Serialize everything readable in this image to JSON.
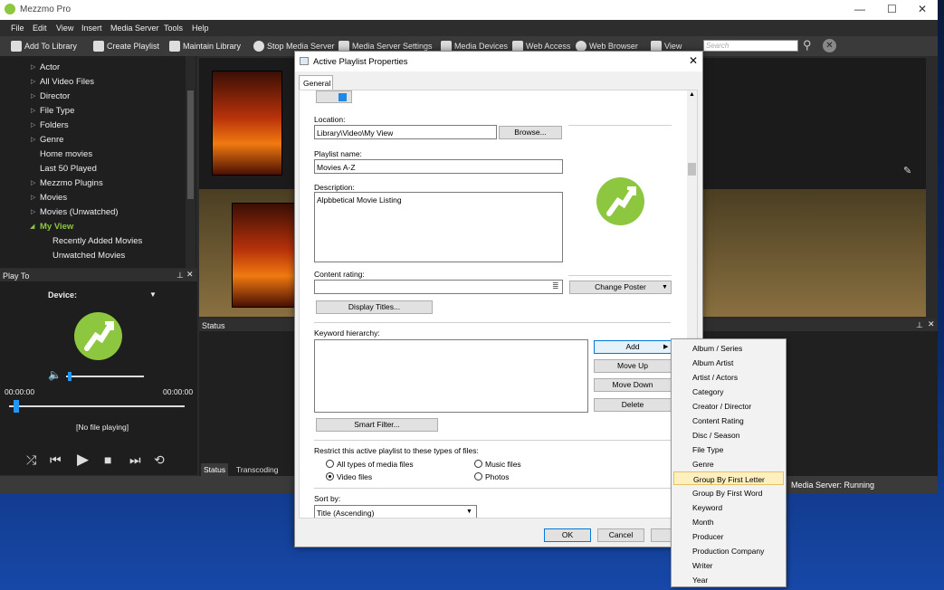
{
  "app": {
    "title": "Mezzmo Pro",
    "window_controls": [
      "—",
      "☐",
      "✕"
    ],
    "menu": [
      "File",
      "Edit",
      "View",
      "Insert",
      "Media Server",
      "Tools",
      "Help"
    ],
    "toolbar": {
      "add_to_library": "Add To Library",
      "create_playlist": "Create Playlist",
      "maintain_library": "Maintain Library",
      "stop_media_server": "Stop Media Server",
      "media_server_settings": "Media Server Settings",
      "media_devices": "Media Devices",
      "web_access": "Web Access",
      "web_browser": "Web Browser",
      "view": "View",
      "search_placeholder": "Search"
    }
  },
  "tree": {
    "items": [
      {
        "label": "Actor",
        "expandable": true
      },
      {
        "label": "All Video Files",
        "expandable": true
      },
      {
        "label": "Director",
        "expandable": true
      },
      {
        "label": "File Type",
        "expandable": true
      },
      {
        "label": "Folders",
        "expandable": true
      },
      {
        "label": "Genre",
        "expandable": true
      },
      {
        "label": "Home movies",
        "expandable": false
      },
      {
        "label": "Last 50 Played",
        "expandable": false
      },
      {
        "label": "Mezzmo Plugins",
        "expandable": true
      },
      {
        "label": "Movies",
        "expandable": true
      },
      {
        "label": "Movies (Unwatched)",
        "expandable": true
      },
      {
        "label": "My View",
        "expandable": true,
        "selected": true
      },
      {
        "label": "Recently Added Movies",
        "child": true
      },
      {
        "label": "Unwatched Movies",
        "child": true
      }
    ]
  },
  "play_to": {
    "header": "Play To",
    "device_label": "Device:",
    "time_start": "00:00:00",
    "time_end": "00:00:00",
    "now_playing": "[No file playing]",
    "volume": 0.02,
    "progress": 0.04
  },
  "status_panel": {
    "header": "Status",
    "tabs": [
      "Status",
      "Transcoding"
    ],
    "media_server_status": "Media Server: Running"
  },
  "dialog": {
    "title": "Active Playlist Properties",
    "tab": "General",
    "location_label": "Location:",
    "location_value": "Library\\Video\\My View",
    "browse_button": "Browse...",
    "playlist_name_label": "Playlist name:",
    "playlist_name_value": "Movies A-Z",
    "description_label": "Description:",
    "description_value": "Alpbbetical Movie Listing",
    "content_rating_label": "Content rating:",
    "content_rating_value": "",
    "change_poster_button": "Change Poster",
    "display_titles_button": "Display Titles...",
    "keyword_hierarchy_label": "Keyword hierarchy:",
    "add_button": "Add",
    "move_up_button": "Move Up",
    "move_down_button": "Move Down",
    "delete_button": "Delete",
    "smart_filter_button": "Smart Filter...",
    "restrict_label": "Restrict this active playlist to these types of files:",
    "file_types": [
      {
        "label": "All types of media files",
        "checked": false
      },
      {
        "label": "Music files",
        "checked": false
      },
      {
        "label": "Video files",
        "checked": true
      },
      {
        "label": "Photos",
        "checked": false
      }
    ],
    "sort_by_label": "Sort by:",
    "sort_by_value": "Title (Ascending)",
    "ok_button": "OK",
    "cancel_button": "Cancel",
    "help_button": "H"
  },
  "context_menu": {
    "items": [
      "Album / Series",
      "Album Artist",
      "Artist / Actors",
      "Category",
      "Creator / Director",
      "Content Rating",
      "Disc / Season",
      "File Type",
      "Genre",
      "Group By First Letter",
      "Group By First Word",
      "Keyword",
      "Month",
      "Producer",
      "Production Company",
      "Writer",
      "Year"
    ],
    "highlighted": "Group By First Letter"
  },
  "colors": {
    "accent_green": "#8dc63f",
    "dark_bg": "#1f1f1f",
    "menu_highlight": "#fcf0c0"
  }
}
